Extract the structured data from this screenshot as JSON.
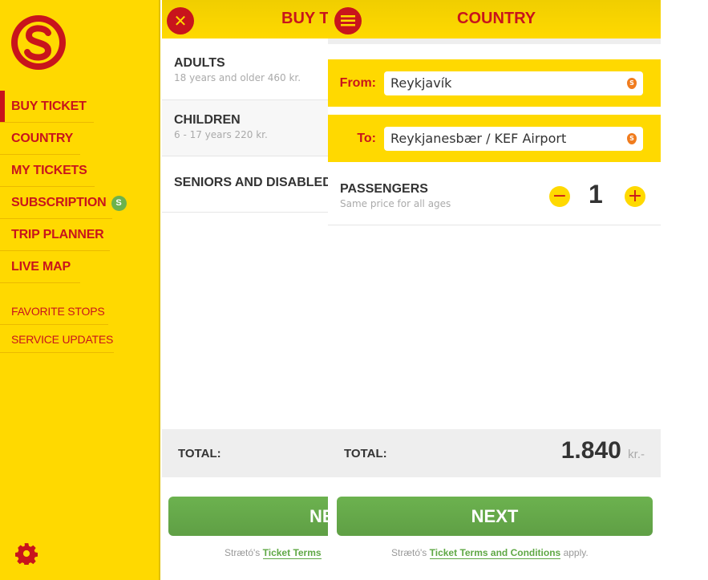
{
  "sidebar": {
    "logo_letter": "S",
    "items": [
      {
        "label": "BUY TICKET",
        "active": true
      },
      {
        "label": "COUNTRY"
      },
      {
        "label": "MY TICKETS"
      },
      {
        "label": "SUBSCRIPTION",
        "badge": "S"
      },
      {
        "label": "TRIP PLANNER"
      },
      {
        "label": "LIVE MAP"
      },
      {
        "label": "FAVORITE STOPS"
      },
      {
        "label": "SERVICE UPDATES"
      }
    ],
    "settings_icon": "gear-icon"
  },
  "buy_panel": {
    "title": "BUY T",
    "close_icon": "close-icon",
    "tickets": [
      {
        "title": "ADULTS",
        "subtitle": "18 years and older 460 kr."
      },
      {
        "title": "CHILDREN",
        "subtitle": "6 - 17 years 220 kr."
      },
      {
        "title": "SENIORS AND DISABLED"
      }
    ],
    "total_label": "TOTAL:",
    "next_label": "NE",
    "terms_prefix": "Strætó's ",
    "terms_link": "Ticket Terms"
  },
  "country_panel": {
    "title": "COUNTRY",
    "menu_icon": "menu-icon",
    "from_label": "From:",
    "from_value": "Reykjavík",
    "to_label": "To:",
    "to_value": "Reykjanesbær / KEF Airport",
    "passengers_title": "PASSENGERS",
    "passengers_subtitle": "Same price for all ages",
    "passengers_count": "1",
    "total_label": "TOTAL:",
    "total_amount": "1.840",
    "total_unit": "kr.-",
    "next_label": "NEXT",
    "terms_prefix": "Strætó's ",
    "terms_link": "Ticket Terms and Conditions",
    "terms_suffix": " apply."
  },
  "colors": {
    "yellow": "#FFD900",
    "red": "#C8141C",
    "green": "#67AB4E"
  }
}
